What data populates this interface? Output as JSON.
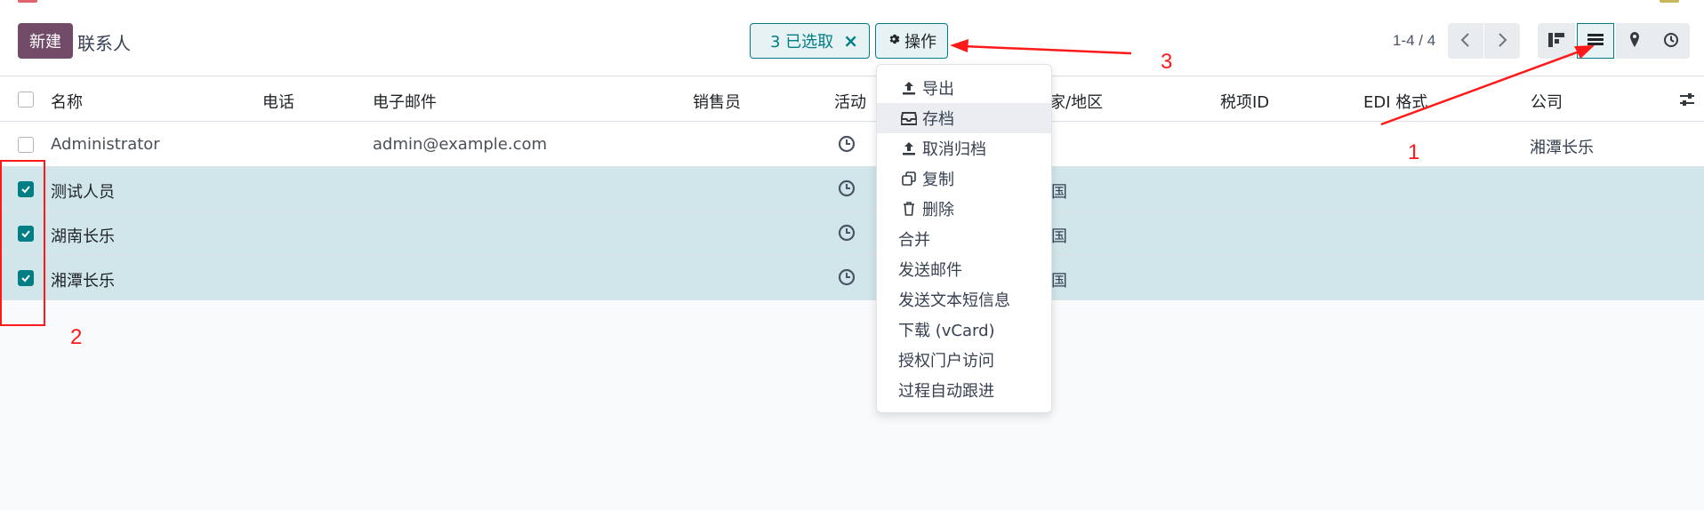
{
  "toolbar": {
    "new_label": "新建",
    "title": "联系人",
    "selected_label": "3 已选取",
    "actions_label": "操作",
    "pager": "1-4 / 4"
  },
  "icons": {
    "close": "close-icon",
    "gear": "gear-icon",
    "prev": "chevron-left-icon",
    "next": "chevron-right-icon",
    "kanban": "kanban-view-icon",
    "list": "list-view-icon",
    "map": "map-pin-icon",
    "activity": "clock-icon",
    "optional_columns": "sliders-icon"
  },
  "columns": {
    "name": "名称",
    "phone": "电话",
    "email": "电子邮件",
    "salesperson": "销售员",
    "activity": "活动",
    "country": "家/地区",
    "tax_id": "税项ID",
    "edi_format": "EDI 格式",
    "company": "公司"
  },
  "rows": [
    {
      "name": "Administrator",
      "email": "admin@example.com",
      "country": "",
      "company": "湘潭长乐",
      "checked": false
    },
    {
      "name": "测试人员",
      "email": "",
      "country": "国",
      "company": "",
      "checked": true
    },
    {
      "name": "湖南长乐",
      "email": "",
      "country": "国",
      "company": "",
      "checked": true
    },
    {
      "name": "湘潭长乐",
      "email": "",
      "country": "国",
      "company": "",
      "checked": true
    }
  ],
  "menu": [
    {
      "label": "导出",
      "icon": "upload-icon"
    },
    {
      "label": "存档",
      "icon": "inbox-icon",
      "hover": true
    },
    {
      "label": "取消归档",
      "icon": "upload-icon"
    },
    {
      "label": "复制",
      "icon": "copy-icon"
    },
    {
      "label": "删除",
      "icon": "trash-icon"
    },
    {
      "label": "合并"
    },
    {
      "label": "发送邮件"
    },
    {
      "label": "发送文本短信息"
    },
    {
      "label": "下载 (vCard)"
    },
    {
      "label": "授权门户访问"
    },
    {
      "label": "过程自动跟进"
    }
  ],
  "annotations": {
    "one": "1",
    "two": "2",
    "three": "3",
    "color": "#ff1a1a"
  },
  "colors": {
    "brand": "#714b67",
    "accent": "#017e84",
    "selected_row": "#d1e6eb"
  }
}
